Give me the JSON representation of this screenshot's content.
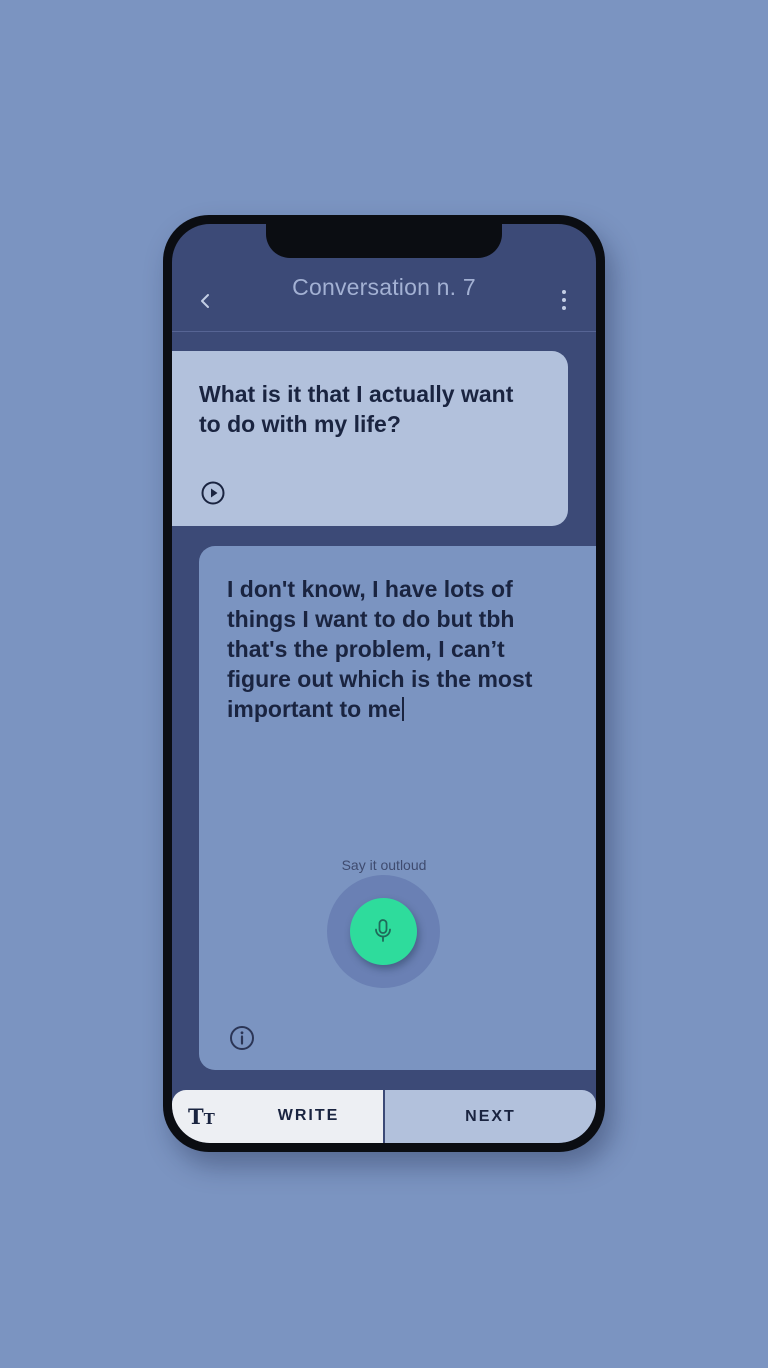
{
  "header": {
    "back_icon": "chevron-left-icon",
    "title": "Conversation n. 7",
    "menu_icon": "more-vertical-icon"
  },
  "question": {
    "text": "What is it that I actually want to do with my life?",
    "play_icon": "play-circle-icon"
  },
  "answer": {
    "text": "I don't know, I have lots of things I want to do but tbh that's the problem, I can’t figure out which is the most important to me",
    "info_icon": "info-circle-icon"
  },
  "voice": {
    "hint": "Say it outloud",
    "mic_icon": "microphone-icon"
  },
  "bottom_bar": {
    "text_size_icon_big": "T",
    "text_size_icon_small": "T",
    "write_label": "WRITE",
    "next_label": "NEXT"
  },
  "colors": {
    "background": "#7b94c1",
    "screen": "#3c4a77",
    "question_card": "#b2c1dc",
    "answer_card": "#7b94c1",
    "mic_accent": "#2edc9c",
    "text_dark": "#1a2440"
  }
}
